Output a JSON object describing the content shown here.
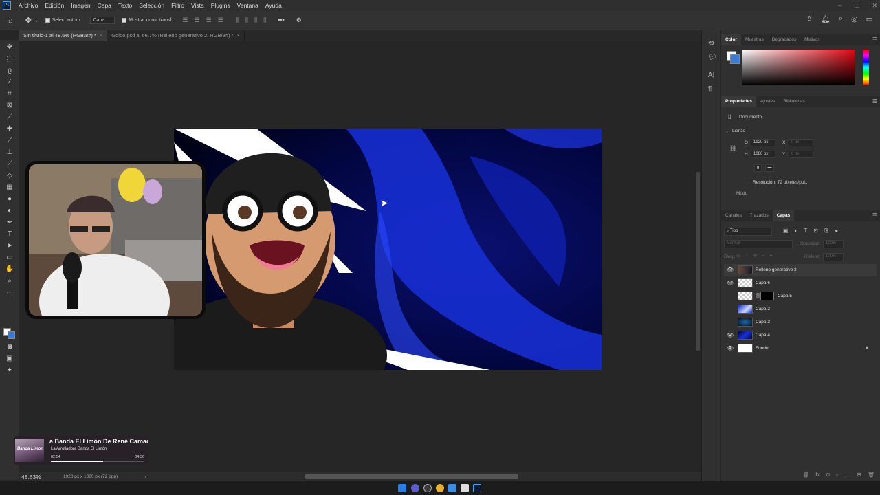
{
  "app": {
    "logo_text": "Ps"
  },
  "menu": [
    "Archivo",
    "Edición",
    "Imagen",
    "Capa",
    "Texto",
    "Selección",
    "Filtro",
    "Vista",
    "Plugins",
    "Ventana",
    "Ayuda"
  ],
  "options_bar": {
    "auto_select_label": "Selec. autom.:",
    "auto_select_value": "Capa",
    "show_transform_label": "Mostrar contr. transf."
  },
  "doc_tabs": [
    {
      "label": "Sin título-1 al 48.6% (RGB/8#) *",
      "active": true
    },
    {
      "label": "Goldo.psd al 66.7% (Relleno generativo 2, RGB/8#) *",
      "active": false
    }
  ],
  "music_widget": {
    "title": "a Banda El Limón De René Camach",
    "artist": "La Arrolladora Banda El Limón",
    "cover_text": "Banda Limon",
    "elapsed": "02:54",
    "duration": "04:36",
    "progress_fraction": 0.56
  },
  "status_bar": {
    "zoom": "48.63%",
    "doc_size": "1920 px x 1080 px (72 ppp)"
  },
  "panels": {
    "color_tabs": [
      "Color",
      "Muestras",
      "Degradados",
      "Motivos"
    ],
    "prop_tabs": [
      "Propiedades",
      "Ajustes",
      "Bibliotecas"
    ],
    "document_label": "Documento",
    "canvas_section": "Lienzo",
    "width_label": "O",
    "width_value": "1920 px",
    "height_label": "H",
    "height_value": "1080 px",
    "x_label": "X",
    "x_value": "0 px",
    "y_label": "Y",
    "y_value": "0 px",
    "resolution": "Resolución:  72 píxeles/pul...",
    "mode_label": "Modo",
    "layer_tabs": [
      "Canales",
      "Trazados",
      "Capas"
    ],
    "filter_label": "Tipo",
    "blend_mode": "Normal",
    "opacity_label": "Opacidad:",
    "opacity_value": "100%",
    "lock_label": "Bloq.:",
    "fill_label": "Relleno:",
    "fill_value": "100%"
  },
  "layers": [
    {
      "name": "Relleno generativo 2",
      "visible": true
    },
    {
      "name": "Capa 6",
      "visible": true
    },
    {
      "name": "Capa 5",
      "visible": false
    },
    {
      "name": "Capa 2",
      "visible": false
    },
    {
      "name": "Capa 3",
      "visible": false
    },
    {
      "name": "Capa 4",
      "visible": true
    },
    {
      "name": "Fondo",
      "visible": true
    }
  ],
  "colors": {
    "accent": "#31a8ff",
    "foreground": "#ffffff",
    "background": "#3a7bd5",
    "picked_hue": "#e30613"
  }
}
